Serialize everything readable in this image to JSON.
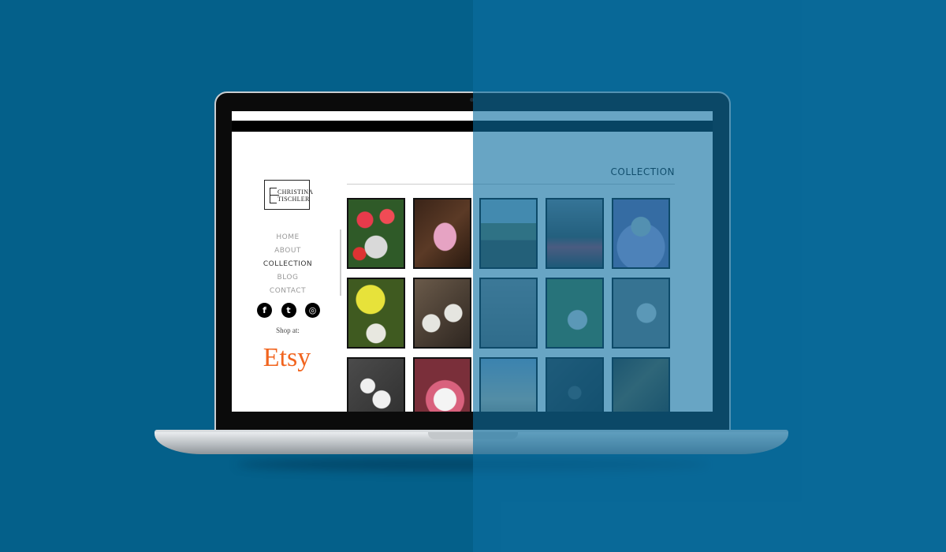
{
  "site": {
    "logo_line1": "CHRISTINA",
    "logo_line2": "TISCHLER",
    "nav": [
      {
        "label": "HOME"
      },
      {
        "label": "ABOUT"
      },
      {
        "label": "COLLECTION"
      },
      {
        "label": "BLOG"
      },
      {
        "label": "CONTACT"
      }
    ],
    "social": {
      "facebook": "f",
      "twitter": "t",
      "instagram": "◎"
    },
    "shop_at": "Shop at:",
    "etsy": "Etsy",
    "page_title": "COLLECTION"
  },
  "colors": {
    "background": "#04608a",
    "overlay": "#0c6ea0",
    "etsy_orange": "#f1641e"
  },
  "icons": [
    "facebook-icon",
    "twitter-icon",
    "instagram-icon"
  ]
}
